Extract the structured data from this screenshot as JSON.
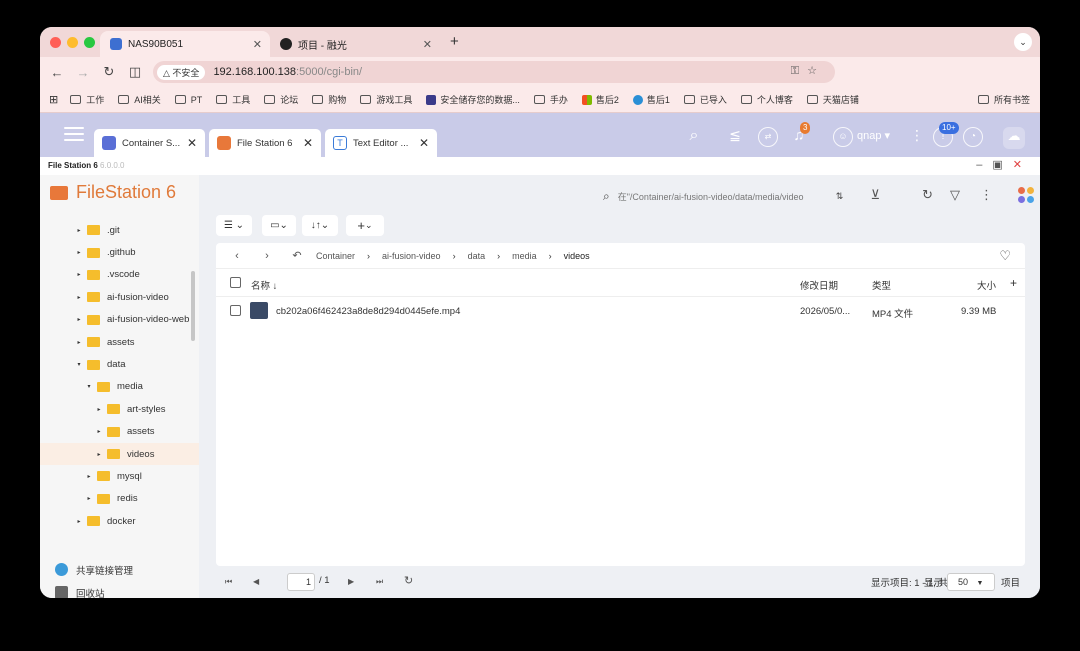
{
  "browser": {
    "tabs": [
      {
        "title": "NAS90B051",
        "active": true
      },
      {
        "title": "项目 - 融光",
        "active": false
      }
    ],
    "url_host": "192.168.100.138",
    "url_path": ":5000/cgi-bin/",
    "security_label": "不安全",
    "bookmarks": [
      "工作",
      "AI相关",
      "PT",
      "工具",
      "论坛",
      "购物",
      "游戏工具",
      "安全储存您的数据...",
      "手办",
      "售后2",
      "售后1",
      "已导入",
      "个人博客",
      "天猫店铺"
    ],
    "all_bookmarks": "所有书签"
  },
  "qts": {
    "app_tabs": [
      {
        "title": "Container S...",
        "color": "#5a6fd6"
      },
      {
        "title": "File Station 6",
        "color": "#e8783a"
      },
      {
        "title": "Text Editor ...",
        "color": "#3b7bd8"
      }
    ],
    "notification_count": "3",
    "update_count": "10+",
    "user": "qnap"
  },
  "app": {
    "window_title": "File Station 6",
    "window_version": "6.0.0.0",
    "brand": "FileStation 6"
  },
  "tree": [
    {
      "label": ".git",
      "depth": 2,
      "arrow": "▸"
    },
    {
      "label": ".github",
      "depth": 2,
      "arrow": "▸"
    },
    {
      "label": ".vscode",
      "depth": 2,
      "arrow": "▸"
    },
    {
      "label": "ai-fusion-video",
      "depth": 2,
      "arrow": "▸"
    },
    {
      "label": "ai-fusion-video-web",
      "depth": 2,
      "arrow": "▸"
    },
    {
      "label": "assets",
      "depth": 2,
      "arrow": "▸"
    },
    {
      "label": "data",
      "depth": 2,
      "arrow": "▾"
    },
    {
      "label": "media",
      "depth": 3,
      "arrow": "▾"
    },
    {
      "label": "art-styles",
      "depth": 4,
      "arrow": "▸"
    },
    {
      "label": "assets",
      "depth": 4,
      "arrow": "▸"
    },
    {
      "label": "videos",
      "depth": 4,
      "arrow": "▸",
      "selected": true
    },
    {
      "label": "mysql",
      "depth": 3,
      "arrow": "▸"
    },
    {
      "label": "redis",
      "depth": 3,
      "arrow": "▸"
    },
    {
      "label": "docker",
      "depth": 2,
      "arrow": "▸"
    }
  ],
  "sidebar_footer": {
    "share": "共享链接管理",
    "recycle": "回收站"
  },
  "search": {
    "placeholder": "在\"/Container/ai-fusion-video/data/media/video"
  },
  "breadcrumb": [
    "Container",
    "ai-fusion-video",
    "data",
    "media",
    "videos"
  ],
  "columns": {
    "name": "名称",
    "modified": "修改日期",
    "type": "类型",
    "size": "大小"
  },
  "files": [
    {
      "name": "cb202a06f462423a8de8d294d0445efe.mp4",
      "modified": "2026/05/0...",
      "type": "MP4 文件",
      "size": "9.39 MB"
    }
  ],
  "pager": {
    "current": "1",
    "total": "/ 1",
    "summary": "显示项目: 1 - 1, 共 1",
    "show_label": "显示",
    "per_page": "50",
    "items_label": "项目"
  }
}
